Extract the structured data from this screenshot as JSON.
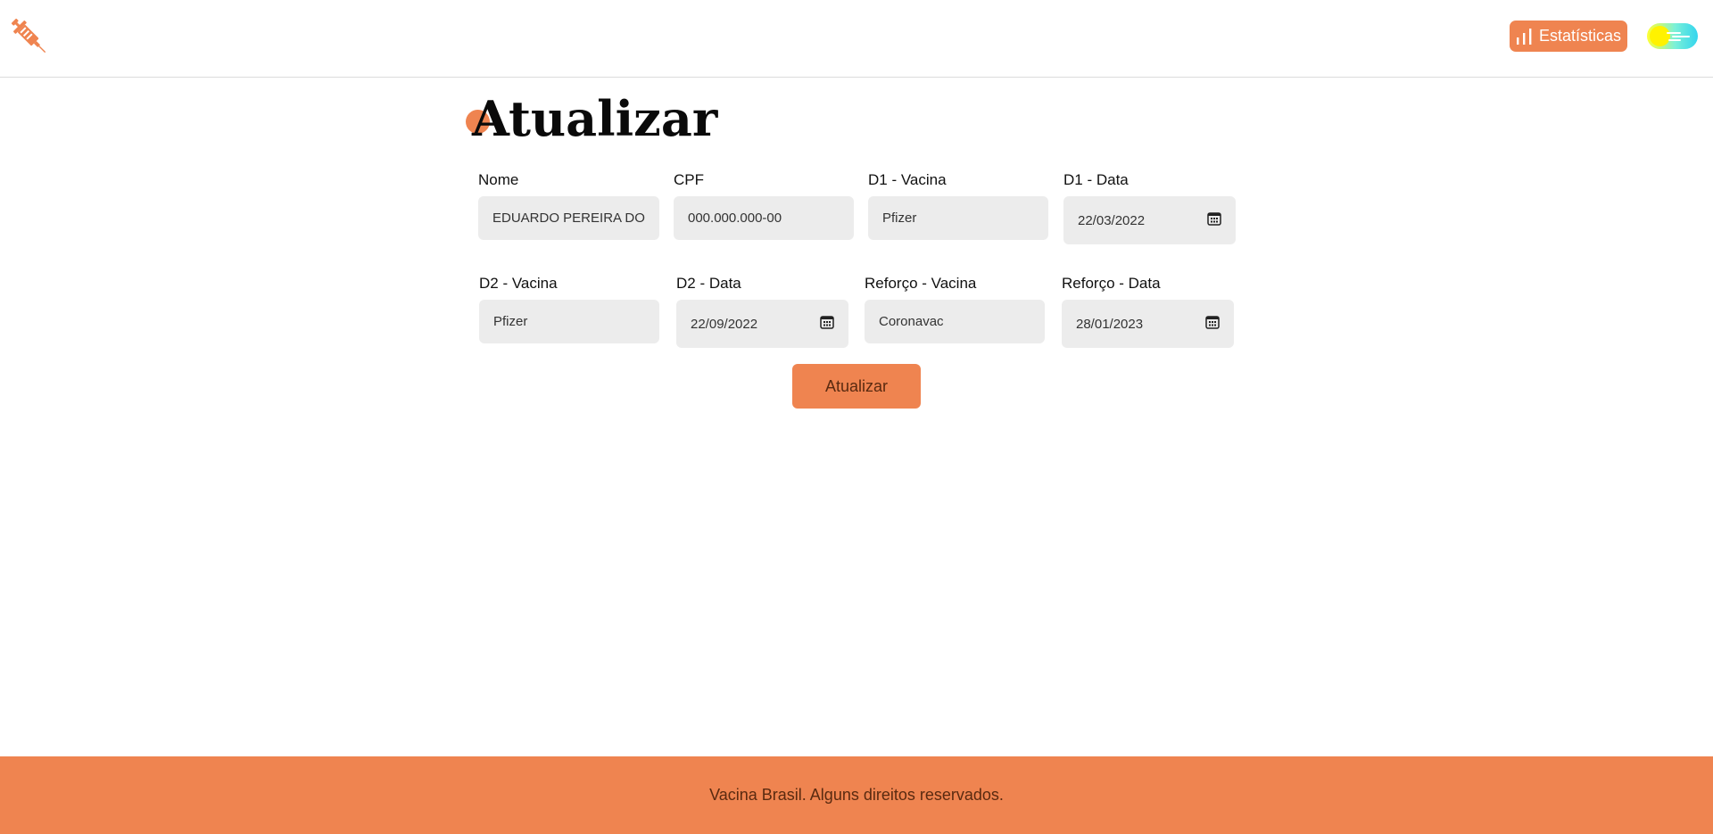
{
  "header": {
    "logo_icon": "syringe-icon",
    "stats_button": {
      "label": "Estatísticas",
      "icon": "bar-chart-icon"
    },
    "theme_toggle": {
      "icon": "theme-toggle-icon"
    }
  },
  "page": {
    "title": "Atualizar"
  },
  "form": {
    "nome": {
      "label": "Nome",
      "value": "EDUARDO PEREIRA DO"
    },
    "cpf": {
      "label": "CPF",
      "value": "000.000.000-00"
    },
    "d1_vacina": {
      "label": "D1 - Vacina",
      "value": "Pfizer"
    },
    "d1_data": {
      "label": "D1 - Data",
      "value": "22/03/2022"
    },
    "d2_vacina": {
      "label": "D2 - Vacina",
      "value": "Pfizer"
    },
    "d2_data": {
      "label": "D2 - Data",
      "value": "22/09/2022"
    },
    "reforco_vacina": {
      "label": "Reforço - Vacina",
      "value": "Coronavac"
    },
    "reforco_data": {
      "label": "Reforço - Data",
      "value": "28/01/2023"
    },
    "submit_label": "Atualizar"
  },
  "footer": {
    "text": "Vacina Brasil. Alguns direitos reservados."
  },
  "colors": {
    "accent": "#ef8450",
    "input_bg": "#ececec",
    "footer_text": "#5a2a10"
  }
}
